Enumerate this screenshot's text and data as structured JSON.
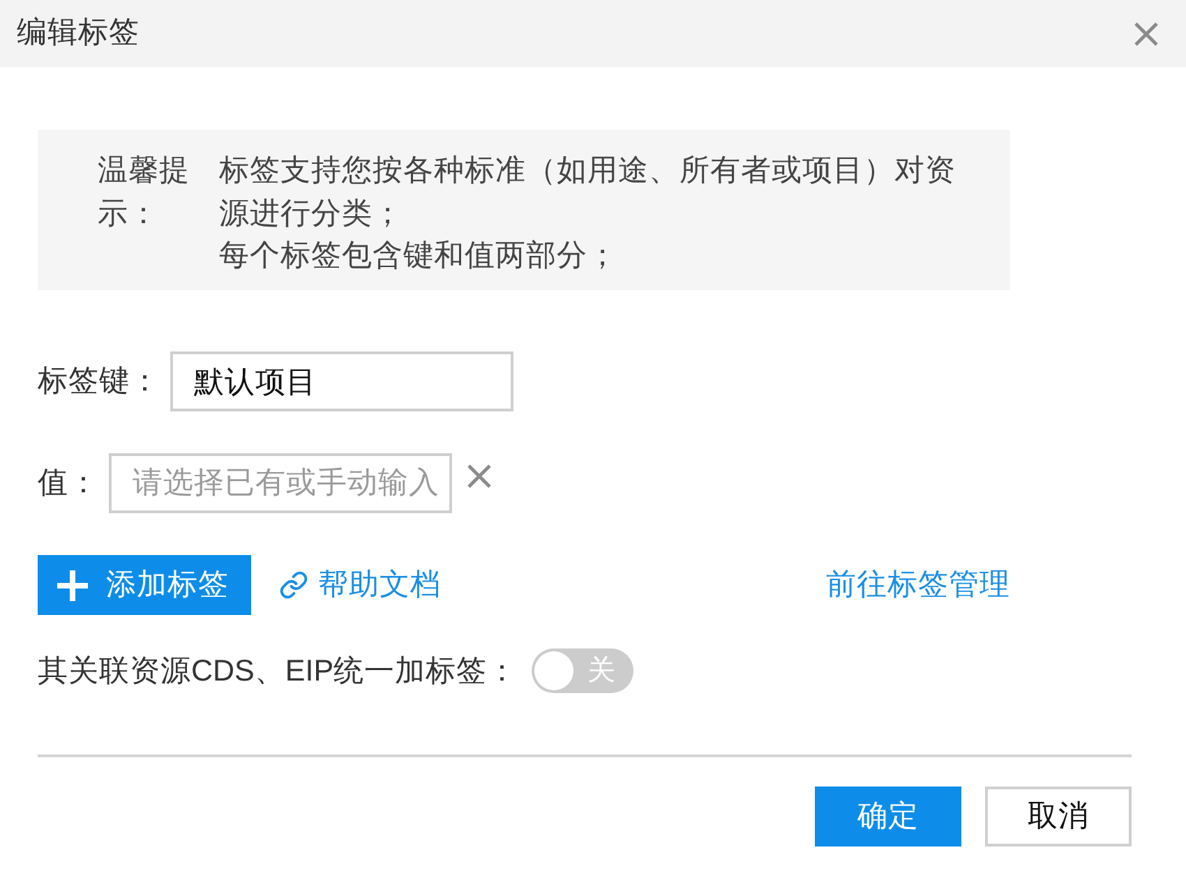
{
  "dialog": {
    "title": "编辑标签"
  },
  "tip": {
    "label": "温馨提示：",
    "lines": [
      "标签支持您按各种标准（如用途、所有者或项目）对资源进行分类；",
      "每个标签包含键和值两部分；"
    ]
  },
  "fields": [
    {
      "label": "标签键：",
      "value": "默认项目",
      "removable": false
    },
    {
      "label": "值：",
      "placeholder": "请选择已有或手动输入",
      "removable": true
    }
  ],
  "actions": {
    "add_button": "添加标签",
    "help_link": "帮助文档",
    "manage_link": "前往标签管理"
  },
  "sync": {
    "label": "其关联资源CDS、EIP统一加标签：",
    "toggle": {
      "on": false,
      "text": "关"
    }
  },
  "footer": {
    "buttons": [
      {
        "label": "确定",
        "kind": "primary"
      },
      {
        "label": "取消",
        "kind": "secondary"
      }
    ]
  }
}
